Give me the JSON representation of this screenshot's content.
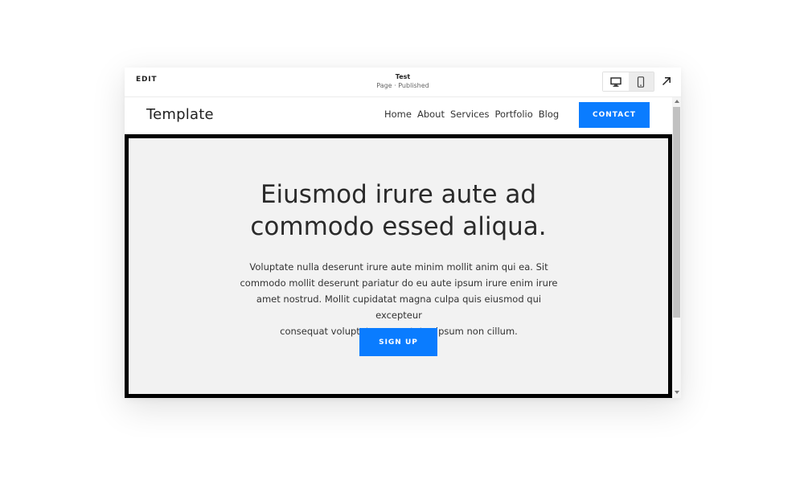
{
  "editor": {
    "edit_label": "EDIT",
    "page_title": "Test",
    "page_status": "Page · Published",
    "devices": [
      {
        "icon": "desktop-icon",
        "active": true
      },
      {
        "icon": "mobile-icon",
        "active": false
      }
    ],
    "external_icon": "arrow-up-right-icon"
  },
  "site": {
    "logo": "Template",
    "nav": [
      {
        "label": "Home"
      },
      {
        "label": "About"
      },
      {
        "label": "Services"
      },
      {
        "label": "Portfolio"
      },
      {
        "label": "Blog"
      }
    ],
    "contact_label": "CONTACT"
  },
  "hero": {
    "title_line1": "Eiusmod irure aute ad",
    "title_line2": "commodo essed aliqua.",
    "body_lines": [
      "Voluptate nulla deserunt irure aute minim mollit anim qui ea. Sit",
      "commodo mollit deserunt pariatur do eu aute ipsum irure enim irure",
      "amet nostrud. Mollit cupidatat magna culpa quis eiusmod qui excepteur",
      "consequat voluptate consectetur ipsum non cillum."
    ],
    "cta_label": "SIGN UP"
  },
  "colors": {
    "accent": "#0a7cff",
    "hero_bg": "#f2f2f2",
    "selection_border": "#000000"
  }
}
